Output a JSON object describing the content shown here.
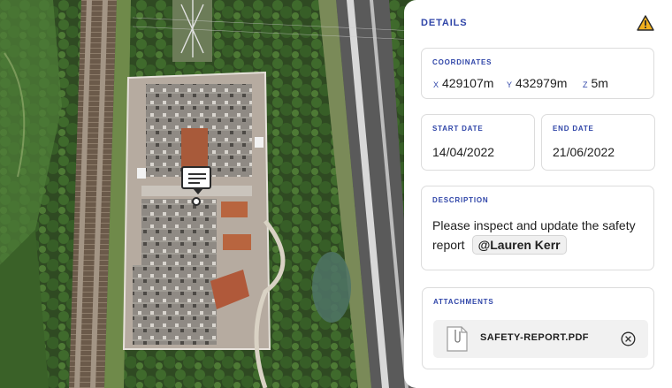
{
  "panel": {
    "title": "DETAILS",
    "warning_icon": "warning-triangle-icon",
    "accent_color": "#2f45a8",
    "warning_color": "#f2b01e"
  },
  "coordinates": {
    "label": "COORDINATES",
    "x_label": "X",
    "x_value": "429107m",
    "y_label": "Y",
    "y_value": "432979m",
    "z_label": "Z",
    "z_value": "5m"
  },
  "start_date": {
    "label": "START DATE",
    "value": "14/04/2022"
  },
  "end_date": {
    "label": "END DATE",
    "value": "21/06/2022"
  },
  "description": {
    "label": "DESCRIPTION",
    "text": "Please inspect and update the safety report",
    "mention": "@Lauren Kerr"
  },
  "attachments": {
    "label": "ATTACHMENTS",
    "files": [
      {
        "name": "SAFETY-REPORT.PDF",
        "icon": "paperclip-document-icon",
        "remove_icon": "remove-circle-icon"
      }
    ]
  },
  "map": {
    "marker_icon": "comment-marker-icon"
  }
}
